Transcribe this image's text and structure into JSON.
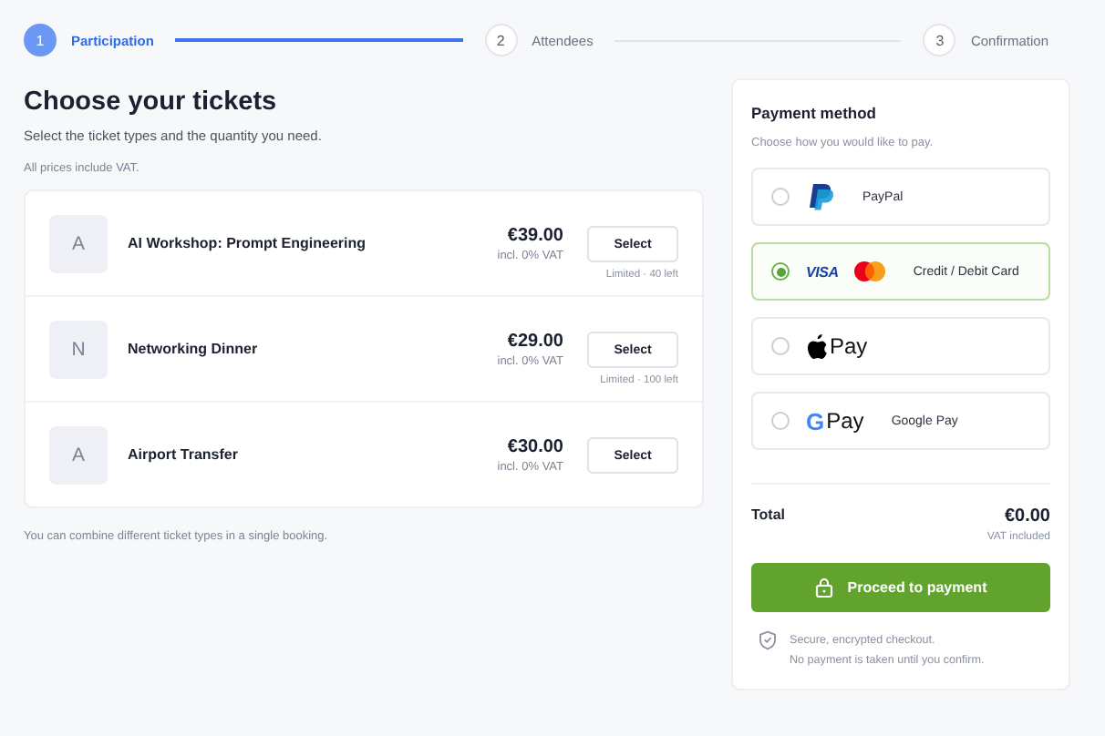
{
  "steps": [
    {
      "number": "1",
      "label": "Participation",
      "selected": true
    },
    {
      "number": "2",
      "label": "Attendees",
      "selected": false
    },
    {
      "number": "3",
      "label": "Confirmation",
      "selected": false
    }
  ],
  "tickets_section": {
    "title": "Choose your tickets",
    "subtitle": "Select the ticket types and the quantity you need.",
    "vat_note": "All prices include VAT.",
    "tickets": [
      {
        "avatar": "A",
        "name": "AI Workshop: Prompt Engineering",
        "price": "€39.00",
        "tax": "incl. 0% VAT",
        "button": "Select",
        "availability": "Limited · 40 left"
      },
      {
        "avatar": "N",
        "name": "Networking Dinner",
        "price": "€29.00",
        "tax": "incl. 0% VAT",
        "button": "Select",
        "availability": "Limited · 100 left"
      },
      {
        "avatar": "A",
        "name": "Airport Transfer",
        "price": "€30.00",
        "tax": "incl. 0% VAT",
        "button": "Select"
      }
    ],
    "footnote": "You can combine different ticket types in a single booking."
  },
  "payment": {
    "title": "Payment method",
    "subtitle": "Choose how you would like to pay.",
    "methods": [
      {
        "kind": "paypal",
        "label": "PayPal",
        "selected": false
      },
      {
        "kind": "card",
        "logo_text": "VISA",
        "label": "Credit / Debit Card",
        "selected": true
      },
      {
        "kind": "applepay",
        "logo_text": "Pay",
        "selected": false
      },
      {
        "kind": "googlepay",
        "mark": "G",
        "logo_text": "Pay",
        "label": "Google Pay",
        "selected": false
      }
    ],
    "total_label": "Total",
    "total": "€0.00",
    "total_note": "VAT included",
    "button": "Proceed to payment",
    "security": [
      "Secure, encrypted checkout.",
      "No payment is taken until you confirm."
    ]
  }
}
